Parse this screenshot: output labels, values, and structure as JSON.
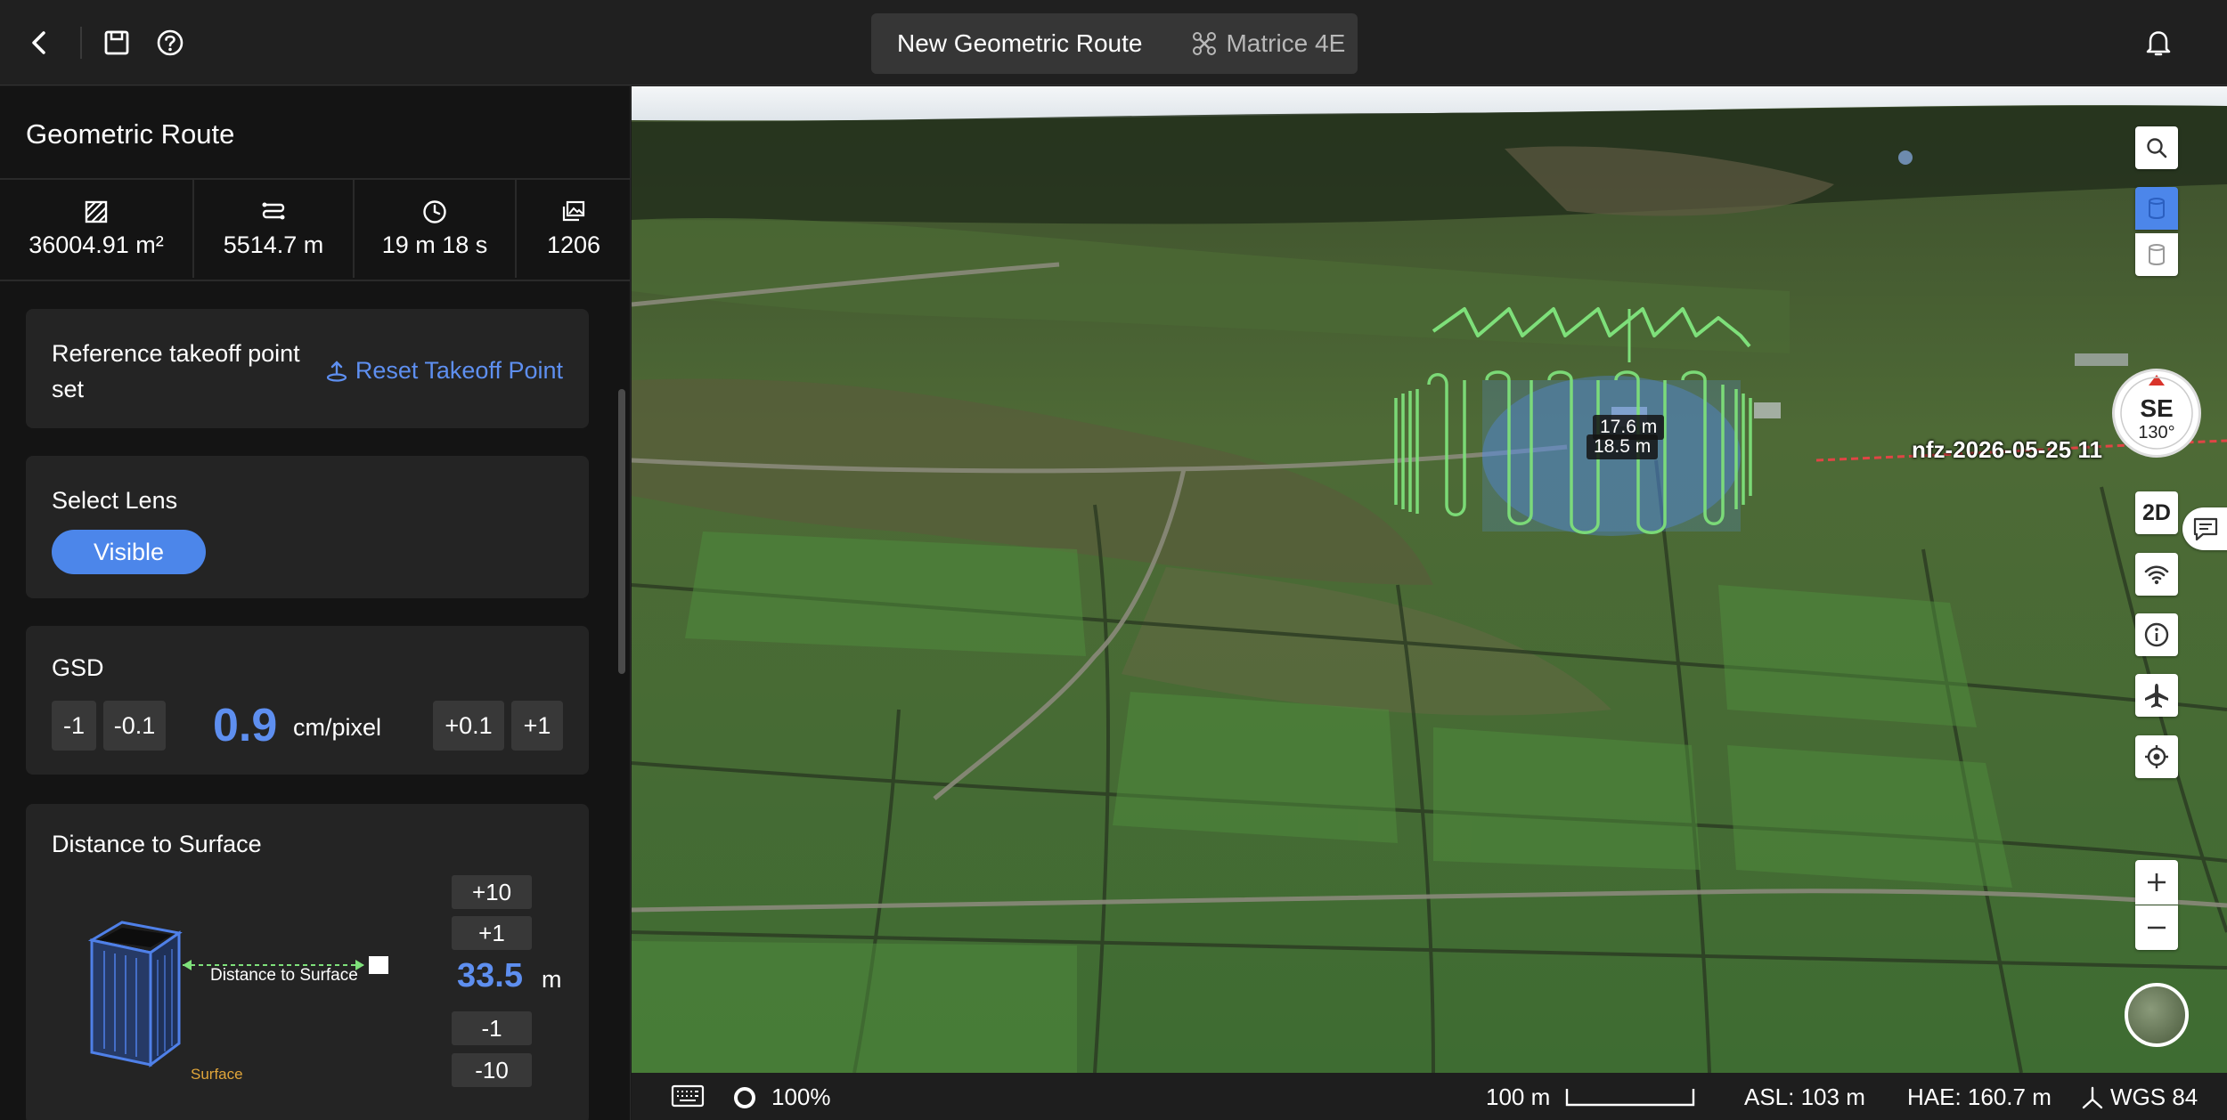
{
  "header": {
    "route_title": "New Geometric Route",
    "drone_model": "Matrice 4E"
  },
  "sidebar": {
    "title": "Geometric Route",
    "stats": [
      {
        "icon": "area-icon",
        "value": "36004.91 m²"
      },
      {
        "icon": "route-length-icon",
        "value": "5514.7 m"
      },
      {
        "icon": "clock-icon",
        "value": "19 m 18 s"
      },
      {
        "icon": "photos-icon",
        "value": "1206"
      }
    ],
    "takeoff": {
      "label": "Reference takeoff point set",
      "reset_label": "Reset Takeoff Point"
    },
    "lens": {
      "label": "Select Lens",
      "selected": "Visible"
    },
    "gsd": {
      "label": "GSD",
      "minus1": "-1",
      "minus01": "-0.1",
      "value": "0.9",
      "unit": "cm/pixel",
      "plus01": "+0.1",
      "plus1": "+1"
    },
    "distance": {
      "label": "Distance to Surface",
      "diagram_label": "Distance to Surface",
      "surface_label": "Surface",
      "plus10": "+10",
      "plus1": "+1",
      "value": "33.5",
      "unit": "m",
      "minus1": "-1",
      "minus10": "-10"
    }
  },
  "map": {
    "nfz_label": "nfz-2026-05-25 11",
    "measure_top": "17.6 m",
    "measure_bottom": "18.5 m",
    "compass_dir": "SE",
    "compass_deg": "130°",
    "view_mode": "2D"
  },
  "status_bar": {
    "zoom": "100%",
    "scale_label": "100 m",
    "asl": "ASL: 103 m",
    "hae": "HAE: 160.7 m",
    "datum": "WGS 84"
  },
  "colors": {
    "accent": "#4c86ea",
    "route_green": "#7ee07a",
    "panel_bg": "#141414",
    "card_bg": "#242424"
  }
}
